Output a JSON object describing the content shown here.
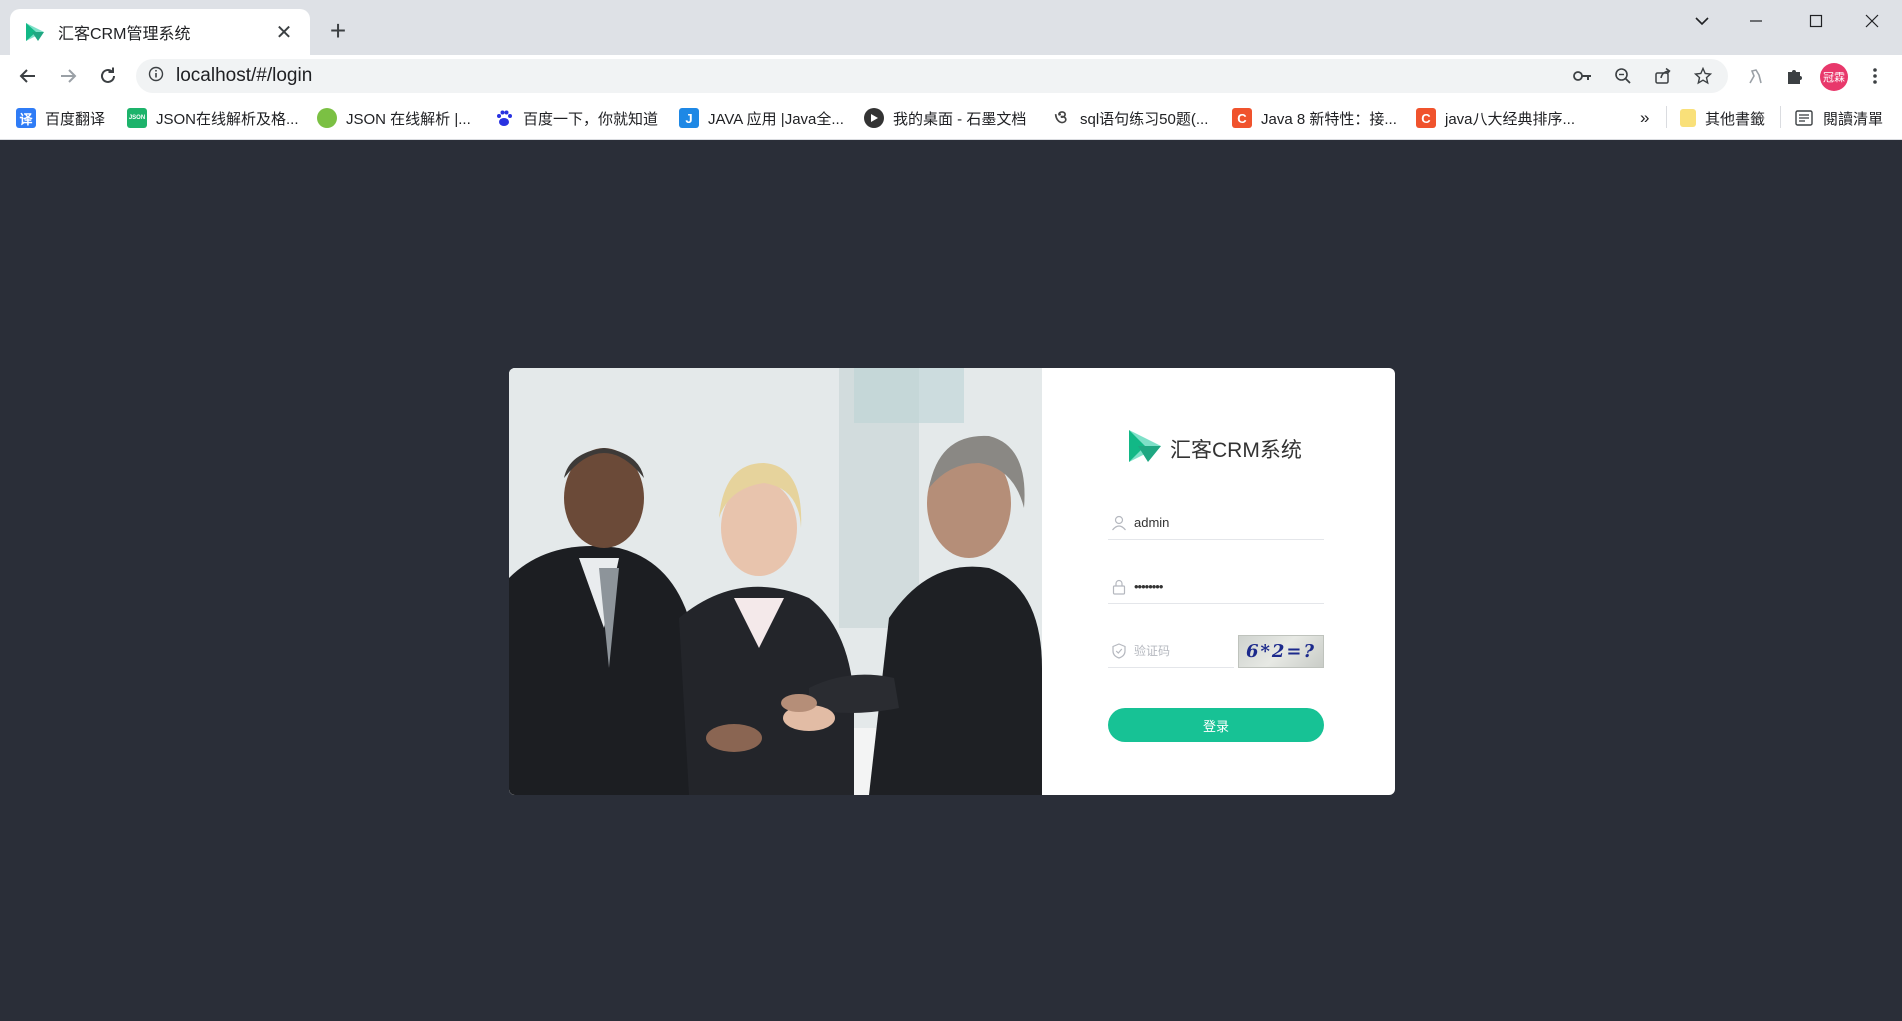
{
  "browser": {
    "tab": {
      "title": "汇客CRM管理系统",
      "close_glyph": "✕",
      "favicon": "huike-logo-icon"
    },
    "new_tab_glyph": "+",
    "address": {
      "url": "localhost/#/login",
      "site_info_icon": "info-icon"
    },
    "bookmarks": [
      {
        "label": "百度翻译",
        "icon": "baidu-translate-icon",
        "color": "#2f7cf6",
        "glyph": "译"
      },
      {
        "label": "JSON在线解析及格...",
        "icon": "json-icon",
        "color": "#1db36b",
        "glyph": ""
      },
      {
        "label": "JSON 在线解析 |...",
        "icon": "json-online-icon",
        "color": "#7bc043",
        "glyph": ""
      },
      {
        "label": "百度一下，你就知道",
        "icon": "baidu-paw-icon",
        "color": "#2932e1",
        "glyph": ""
      },
      {
        "label": "JAVA 应用 |Java全...",
        "icon": "java-app-icon",
        "color": "#1e88e5",
        "glyph": "J"
      },
      {
        "label": "我的桌面 - 石墨文档",
        "icon": "shimo-icon",
        "color": "#333333",
        "glyph": ""
      },
      {
        "label": "sql语句练习50题(...",
        "icon": "sql-icon",
        "color": "#555555",
        "glyph": ""
      },
      {
        "label": "Java 8 新特性：接...",
        "icon": "csdn-icon",
        "color": "#f0532d",
        "glyph": "C"
      },
      {
        "label": "java八大经典排序...",
        "icon": "csdn-icon",
        "color": "#f0532d",
        "glyph": "C"
      }
    ],
    "more_bookmarks_glyph": "»",
    "other_bookmarks": "其他書籤",
    "reading_list": "閱讀清單",
    "profile_initials": "冠霖"
  },
  "login": {
    "brand": "汇客CRM系统",
    "username": "admin",
    "password_mask": "••••••••",
    "captcha_placeholder": "验证码",
    "captcha_text": "6*2=?",
    "submit_label": "登录"
  },
  "colors": {
    "page_bg": "#2a2e38",
    "accent": "#17c295",
    "brand_teal_light": "#7ee0c8",
    "brand_teal_dark": "#12b886"
  }
}
